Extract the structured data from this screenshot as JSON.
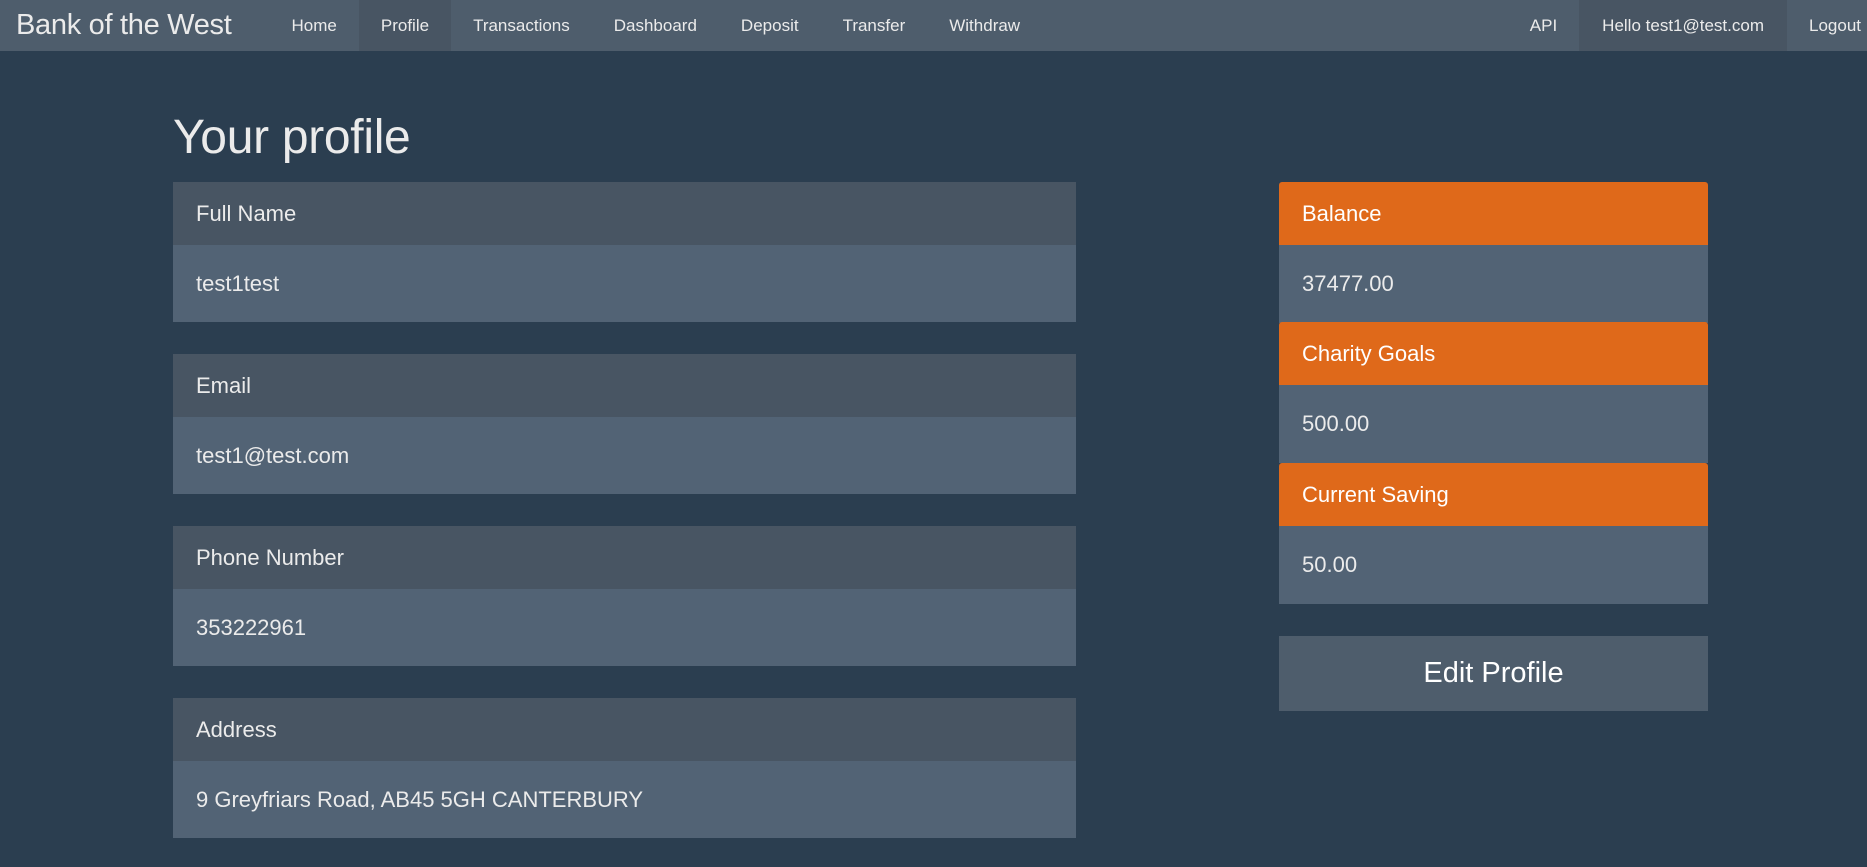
{
  "navbar": {
    "brand": "Bank of the West",
    "left_items": [
      "Home",
      "Profile",
      "Transactions",
      "Dashboard",
      "Deposit",
      "Transfer",
      "Withdraw"
    ],
    "active_item": "Profile",
    "api_label": "API",
    "hello_label": "Hello test1@test.com",
    "logout_label": "Logout"
  },
  "page": {
    "title": "Your profile"
  },
  "profile": {
    "full_name": {
      "label": "Full Name",
      "value": "test1test"
    },
    "email": {
      "label": "Email",
      "value": "test1@test.com"
    },
    "phone": {
      "label": "Phone Number",
      "value": "353222961"
    },
    "address": {
      "label": "Address",
      "value": "9 Greyfriars Road, AB45 5GH CANTERBURY"
    }
  },
  "summary": {
    "balance": {
      "label": "Balance",
      "value": "37477.00"
    },
    "charity": {
      "label": "Charity Goals",
      "value": "500.00"
    },
    "saving": {
      "label": "Current Saving",
      "value": "50.00"
    }
  },
  "actions": {
    "edit_profile": "Edit Profile"
  },
  "colors": {
    "background": "#2b3e50",
    "navbar": "#4e5d6c",
    "accent": "#df691a",
    "panel_heading": "#485563",
    "panel_body": "#526375"
  }
}
